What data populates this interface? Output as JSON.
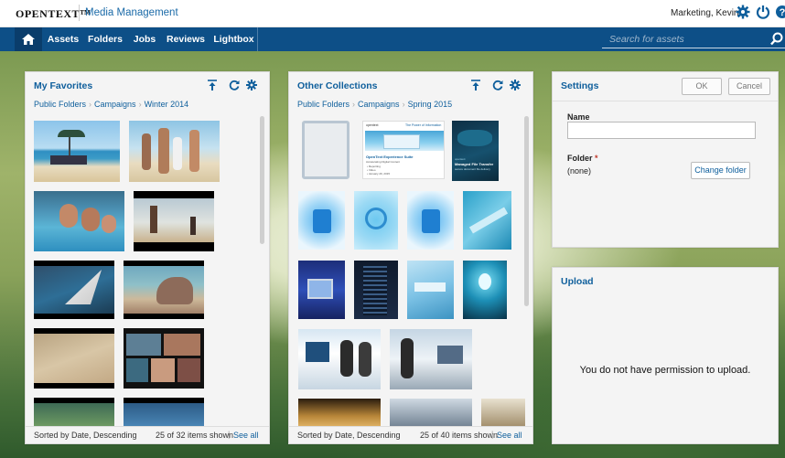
{
  "brand": "OPENTEXT™",
  "app_name": "Media Management",
  "user": "Marketing, Kevin",
  "icons": {
    "settings": "gear-icon",
    "power": "power-icon",
    "help": "help-icon",
    "home": "home-icon",
    "search": "search-icon"
  },
  "nav": {
    "assets": "Assets",
    "folders": "Folders",
    "jobs": "Jobs",
    "reviews": "Reviews",
    "lightbox": "Lightbox"
  },
  "search": {
    "placeholder": "Search for assets"
  },
  "favorites": {
    "title": "My Favorites",
    "crumbs": [
      "Public Folders",
      "Campaigns",
      "Winter 2014"
    ],
    "sorted": "Sorted by Date, Descending",
    "count": "25 of 32 items shown",
    "see_all": "See all"
  },
  "collections": {
    "title": "Other Collections",
    "crumbs": [
      "Public Folders",
      "Campaigns",
      "Spring 2015"
    ],
    "sorted": "Sorted by Date, Descending",
    "count": "25 of 40 items shown",
    "see_all": "See all",
    "brochure": {
      "brand": "opentext",
      "tagline": "The Power of Information",
      "heading": "OpenText Experience Suite",
      "sub": "Accelerating Digital Content",
      "bullets": [
        "• Reporting",
        "• Video",
        "• January 29, 2015"
      ]
    },
    "mft": {
      "brand": "opentext",
      "title": "Managed File Transfer",
      "sub": "secure document file delivery"
    }
  },
  "settings": {
    "title": "Settings",
    "ok": "OK",
    "cancel": "Cancel",
    "name_label": "Name",
    "name_value": "",
    "folder_label": "Folder",
    "folder_required": "*",
    "folder_value": "(none)",
    "change_folder": "Change folder"
  },
  "upload": {
    "title": "Upload",
    "message": "You do not have permission to upload."
  }
}
